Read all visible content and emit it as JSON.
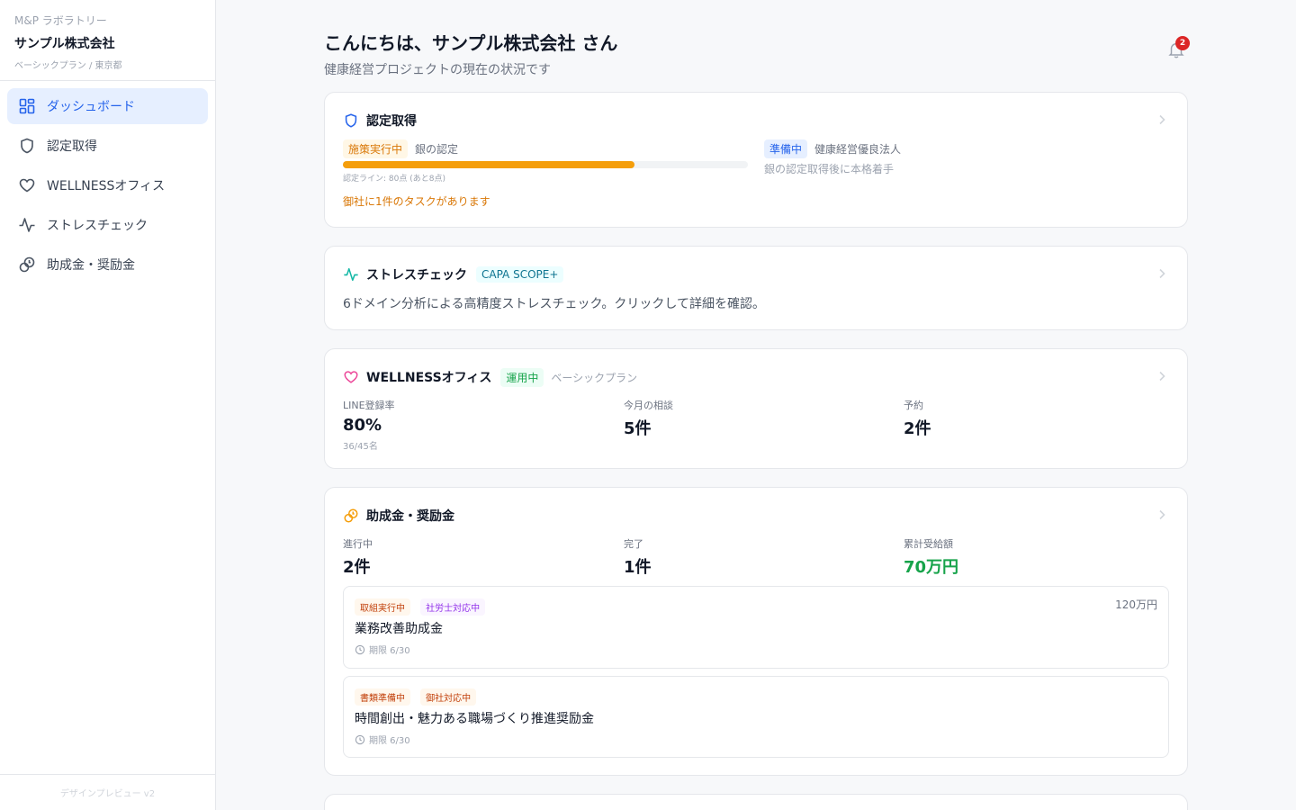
{
  "sidebar": {
    "org_label": "M&P ラボラトリー",
    "org_name": "サンプル株式会社",
    "org_plan": "ベーシックプラン / 東京都",
    "items": [
      {
        "label": "ダッシュボード",
        "icon": "dashboard-icon"
      },
      {
        "label": "認定取得",
        "icon": "shield-icon"
      },
      {
        "label": "WELLNESSオフィス",
        "icon": "heart-icon"
      },
      {
        "label": "ストレスチェック",
        "icon": "pulse-icon"
      },
      {
        "label": "助成金・奨励金",
        "icon": "coins-icon"
      }
    ],
    "footer": "デザインプレビュー v2"
  },
  "header": {
    "greeting": "こんにちは、サンプル株式会社 さん",
    "subtitle": "健康経営プロジェクトの現在の状況です",
    "notification_count": "2"
  },
  "certification": {
    "title": "認定取得",
    "current_status": "施策実行中",
    "current_name": "銀の認定",
    "progress": 0.72,
    "line_note": "認定ライン: 80点 (あと8点)",
    "task_note": "御社に1件のタスクがあります",
    "next_status": "準備中",
    "next_name": "健康経営優良法人",
    "next_note": "銀の認定取得後に本格着手"
  },
  "stress": {
    "title": "ストレスチェック",
    "badge": "CAPA SCOPE+",
    "description": "6ドメイン分析による高精度ストレスチェック。クリックして詳細を確認。"
  },
  "wellness": {
    "title": "WELLNESSオフィス",
    "status": "運用中",
    "plan": "ベーシックプラン",
    "stats": [
      {
        "label": "LINE登録率",
        "value": "80%",
        "note": "36/45名"
      },
      {
        "label": "今月の相談",
        "value": "5件"
      },
      {
        "label": "予約",
        "value": "2件"
      }
    ]
  },
  "subsidies": {
    "title": "助成金・奨励金",
    "stats": [
      {
        "label": "進行中",
        "value": "2件"
      },
      {
        "label": "完了",
        "value": "1件"
      },
      {
        "label": "累計受給額",
        "value": "70万円"
      }
    ],
    "items": [
      {
        "tags": [
          "取組実行中",
          "社労士対応中"
        ],
        "name": "業務改善助成金",
        "deadline": "期限 6/30",
        "amount": "120万円"
      },
      {
        "tags": [
          "書類準備中",
          "御社対応中"
        ],
        "name": "時間創出・魅力ある職場づくり推進奨励金",
        "deadline": "期限 6/30",
        "amount": ""
      }
    ]
  },
  "colors": {
    "accent": "#2563eb",
    "orange": "#f59e0b",
    "teal": "#14b8a6",
    "pink": "#ec4899",
    "green": "#16a34a"
  }
}
